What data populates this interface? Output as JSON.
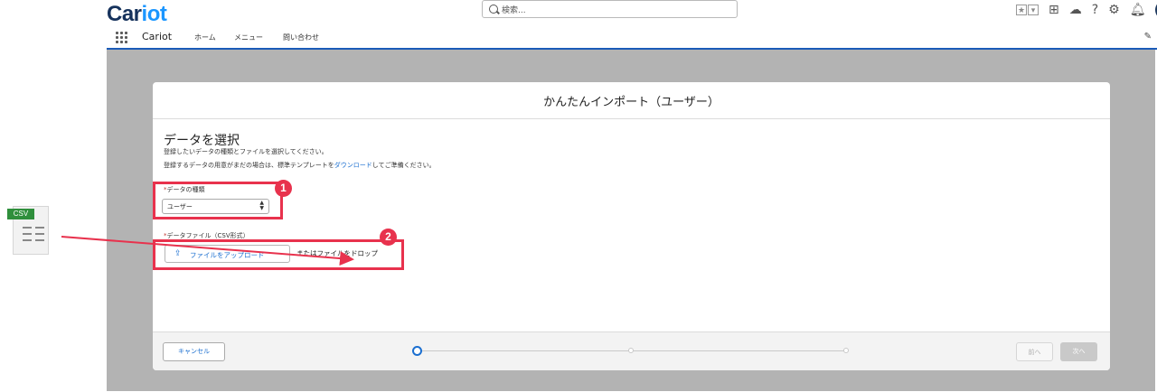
{
  "header": {
    "logo_main": "Car",
    "logo_accent": "iot",
    "search_placeholder": "検索..."
  },
  "nav": {
    "app_name": "Cariot",
    "items": [
      "ホーム",
      "メニュー",
      "問い合わせ"
    ]
  },
  "modal": {
    "title": "かんたんインポート（ユーザー）",
    "heading": "データを選択",
    "desc1": "登録したいデータの種類とファイルを選択してください。",
    "desc2_pre": "登録するデータの用意がまだの場合は、標準テンプレートを",
    "desc2_link": "ダウンロード",
    "desc2_post": "してご準備ください。",
    "required_mark": "*",
    "data_type_label": "データの種類",
    "data_type_value": "ユーザー",
    "file_label": "データファイル（CSV形式）",
    "upload_button": "ファイルをアップロード",
    "drop_text": "またはファイルをドロップ",
    "cancel_button": "キャンセル",
    "prev_button": "前へ",
    "next_button": "次へ",
    "steps_total": 3,
    "current_step": 1
  },
  "annotations": {
    "badge1": "1",
    "badge2": "2",
    "csv_tag": "CSV",
    "color": "#e8324d"
  }
}
